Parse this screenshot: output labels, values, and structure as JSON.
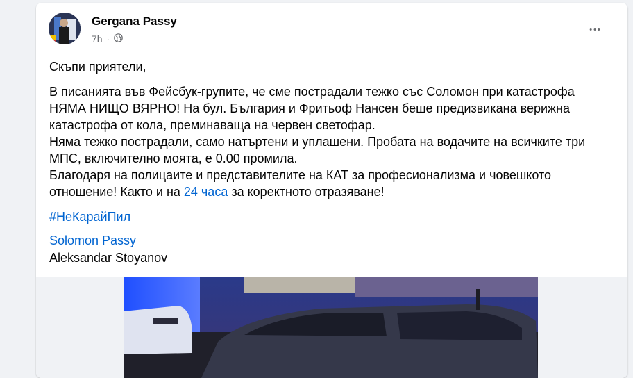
{
  "post": {
    "author": "Gergana Passy",
    "time": "7h",
    "dot": "·",
    "more_label": "•••",
    "greeting": "Скъпи приятели,",
    "paragraph_lines": [
      "В писанията във Фейсбук-групите, че сме пострадали тежко със Соломон при катастрофа",
      "НЯМА НИЩО ВЯРНО! На бул. България и Фритьоф Нансен беше предизвикана верижна",
      "катастрофа от кола, преминаваща на червен светофар.",
      "Няма тежко пострадали, само натъртени и уплашени. Пробата на водачите на всичките три",
      "МПС, включително моята, е 0.00 промила.",
      "Благодаря на полицаите и представителите на КАТ за професионализма и човешкото"
    ],
    "last_line_prefix": "отношение! Както и на ",
    "last_line_link": "24 часа",
    "last_line_suffix": " за коректното отразяване!",
    "hashtag": "#НеКарайПил",
    "mention_1": "Solomon Passy",
    "mention_2": "Aleksandar Stoyanov"
  },
  "colors": {
    "link": "#0064d1",
    "text": "#050505",
    "secondary": "#65676b"
  },
  "icons": {
    "privacy": "globe-icon",
    "menu": "more-options-icon"
  }
}
